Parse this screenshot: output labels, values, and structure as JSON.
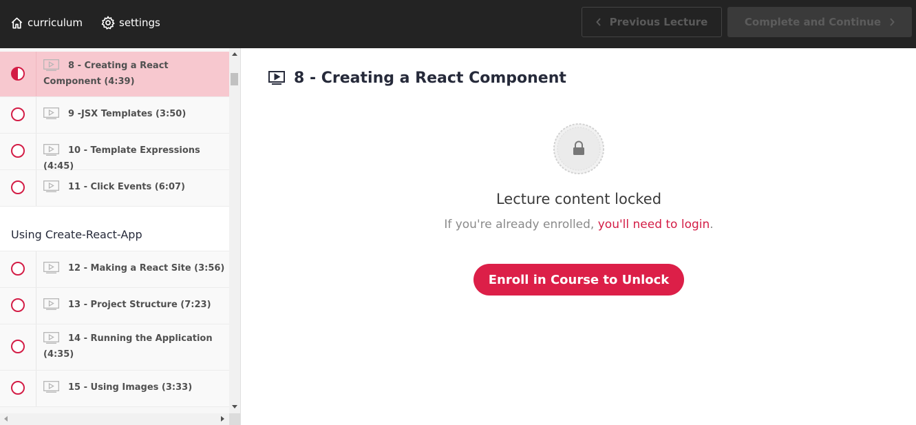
{
  "header": {
    "curriculum_label": "curriculum",
    "settings_label": "settings",
    "previous_label": "Previous Lecture",
    "complete_label": "Complete and Continue"
  },
  "sidebar": {
    "items": [
      {
        "label": "8 - Creating a React Component (4:39)",
        "status": "in-progress",
        "active": true
      },
      {
        "label": "9 -JSX Templates (3:50)",
        "status": "incomplete"
      },
      {
        "label": "10 - Template Expressions (4:45)",
        "status": "incomplete"
      },
      {
        "label": "11 - Click Events (6:07)",
        "status": "incomplete"
      }
    ],
    "section": {
      "title": "Using Create-React-App",
      "items": [
        {
          "label": "12 - Making a React Site (3:56)",
          "status": "incomplete"
        },
        {
          "label": "13 - Project Structure (7:23)",
          "status": "incomplete"
        },
        {
          "label": "14 - Running the Application (4:35)",
          "status": "incomplete"
        },
        {
          "label": "15 - Using Images (3:33)",
          "status": "incomplete"
        }
      ]
    }
  },
  "main": {
    "lecture_title": "8 - Creating a React Component",
    "locked_heading": "Lecture content locked",
    "locked_sub_prefix": "If you're already enrolled, ",
    "locked_sub_link": "you'll need to login",
    "locked_sub_suffix": ".",
    "enroll_label": "Enroll in Course to Unlock"
  },
  "colors": {
    "accent": "#dc1f48",
    "topbar_bg": "#232323",
    "active_row_bg": "#f7c8cf"
  },
  "icons": {
    "curriculum": "home-icon",
    "settings": "gear-icon",
    "previous": "chevron-left-icon",
    "next": "chevron-right-icon",
    "lecture_type": "video-icon",
    "lock": "lock-icon"
  }
}
